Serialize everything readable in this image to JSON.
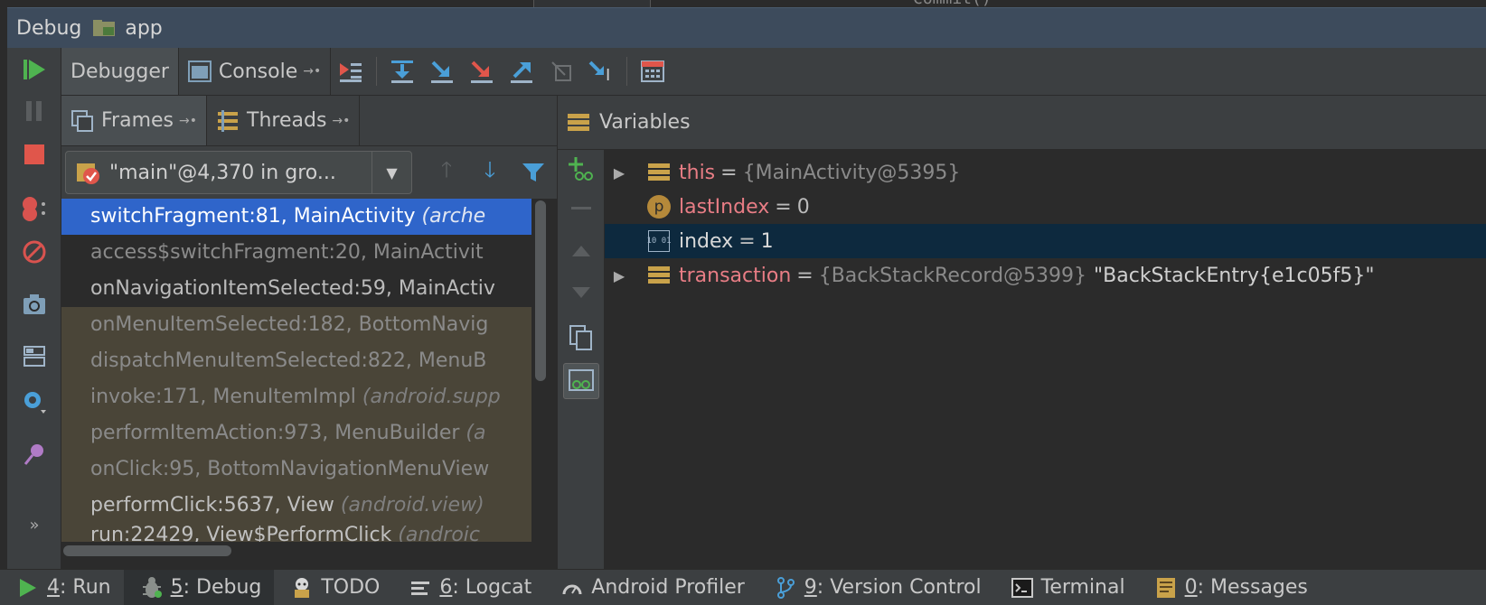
{
  "window": {
    "title_prefix": "Debug",
    "project": "app",
    "editor_fragment": "Commit()"
  },
  "tabs": {
    "debugger": "Debugger",
    "console": "Console"
  },
  "frames_panel": {
    "frames_tab": "Frames",
    "threads_tab": "Threads",
    "thread_selector": "\"main\"@4,370 in gro...",
    "frames": [
      {
        "method": "switchFragment:81, MainActivity ",
        "pkg": "(arche"
      },
      {
        "method": "access$switchFragment:20, MainActivit",
        "pkg": ""
      },
      {
        "method": "onNavigationItemSelected:59, MainActiv",
        "pkg": ""
      },
      {
        "method": "onMenuItemSelected:182, BottomNavig",
        "pkg": ""
      },
      {
        "method": "dispatchMenuItemSelected:822, MenuB",
        "pkg": ""
      },
      {
        "method": "invoke:171, MenuItemImpl ",
        "pkg": "(android.supp"
      },
      {
        "method": "performItemAction:973, MenuBuilder ",
        "pkg": "(a"
      },
      {
        "method": "onClick:95, BottomNavigationMenuView",
        "pkg": ""
      },
      {
        "method": "performClick:5637, View ",
        "pkg": "(android.view)"
      },
      {
        "method": "run:22429, View$PerformClick ",
        "pkg": "(androic"
      }
    ]
  },
  "variables_panel": {
    "title": "Variables",
    "vars": [
      {
        "name": "this",
        "type": "{MainActivity@5395}",
        "value": "",
        "string": ""
      },
      {
        "name": "lastIndex",
        "type": "",
        "value": "0",
        "string": ""
      },
      {
        "name": "index",
        "type": "",
        "value": "1",
        "string": ""
      },
      {
        "name": "transaction",
        "type": "{BackStackRecord@5399}",
        "value": "",
        "string": "\"BackStackEntry{e1c05f5}\""
      }
    ],
    "equals": "=",
    "param_badge": "p",
    "prim_badge": "10 01"
  },
  "status_bar": {
    "run_num": "4",
    "run_label": ": Run",
    "debug_num": "5",
    "debug_label": ": Debug",
    "todo": "TODO",
    "logcat_num": "6",
    "logcat_label": ": Logcat",
    "profiler": "Android Profiler",
    "vcs_num": "9",
    "vcs_label": ": Version Control",
    "terminal": "Terminal",
    "messages_num": "0",
    "messages_label": ": Messages"
  },
  "colors": {
    "accent_selection": "#2f65ca",
    "variable_name": "#e87d85",
    "run_green": "#4fb350",
    "stop_red": "#e0564b"
  }
}
